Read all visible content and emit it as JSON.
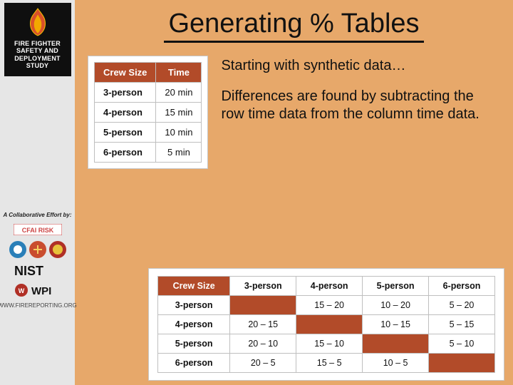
{
  "sidebar": {
    "badge_lines": [
      "FIRE FIGHTER",
      "SAFETY AND",
      "DEPLOYMENT",
      "STUDY"
    ],
    "collab_label": "A Collaborative Effort by:",
    "url": "WWW.FIREREPORTING.ORG"
  },
  "title": "Generating % Tables",
  "para1": "Starting with synthetic data…",
  "para2": "Differences are found by subtracting the row time data from the column time data.",
  "table1": {
    "headers": [
      "Crew Size",
      "Time"
    ],
    "rows": [
      [
        "3-person",
        "20 min"
      ],
      [
        "4-person",
        "15 min"
      ],
      [
        "5-person",
        "10 min"
      ],
      [
        "6-person",
        "5 min"
      ]
    ]
  },
  "table2": {
    "corner": "Crew Size",
    "cols": [
      "3-person",
      "4-person",
      "5-person",
      "6-person"
    ],
    "rows": [
      "3-person",
      "4-person",
      "5-person",
      "6-person"
    ],
    "cells": [
      [
        "",
        "15 – 20",
        "10 – 20",
        "5 – 20"
      ],
      [
        "20 – 15",
        "",
        "10 – 15",
        "5 – 15"
      ],
      [
        "20 – 10",
        "15 – 10",
        "",
        "5 – 10"
      ],
      [
        "20 – 5",
        "15 – 5",
        "10 – 5",
        ""
      ]
    ]
  },
  "colors": {
    "accent": "#b24b29",
    "bg": "#e7a86a"
  }
}
